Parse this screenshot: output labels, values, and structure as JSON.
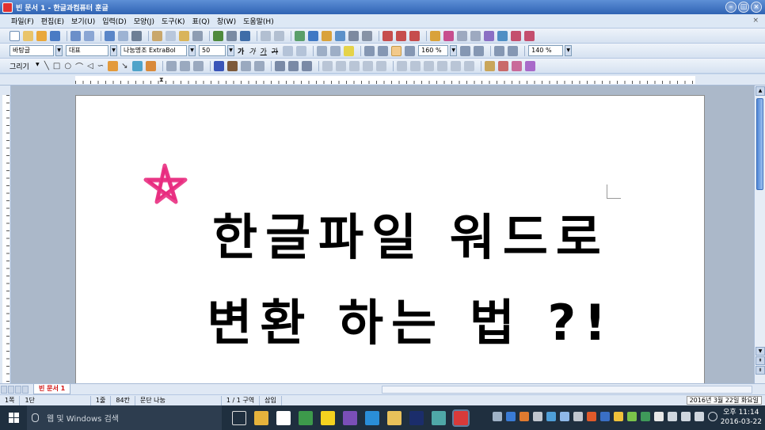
{
  "window": {
    "title": "빈 문서 1 - 한글과컴퓨터 훈글",
    "controls": [
      "–",
      "□",
      "×"
    ]
  },
  "menubar": {
    "items": [
      "파일(F)",
      "편집(E)",
      "보기(U)",
      "입력(D)",
      "모양(J)",
      "도구(K)",
      "표(Q)",
      "창(W)",
      "도움말(H)"
    ],
    "close": "×"
  },
  "formatting": {
    "style": "바탕글",
    "language": "대표",
    "font": "나눔명조 ExtraBol",
    "size": "50",
    "bold": "가",
    "italic": "가",
    "underline": "가",
    "strike": "가",
    "line_spacing": "160 %",
    "zoom": "140 %"
  },
  "drawing_toolbar": {
    "label": "그리기"
  },
  "document": {
    "line1": "한글파일 워드로",
    "line2": "변환 하는 법 ?!",
    "star_color": "#e8237a"
  },
  "tabs": {
    "active": "빈 문서 1"
  },
  "status": {
    "page": "1쪽",
    "col": "1단",
    "line": "1줄",
    "char": "84칸",
    "division": "문단 나눔",
    "section": "1 / 1 구역",
    "mode": "삽입",
    "date_tooltip": "2016년 3월 22일 화요일"
  },
  "taskbar": {
    "search_placeholder": "웹 및 Windows 검색",
    "time_ampm": "오후 11:14",
    "date": "2016-03-22"
  }
}
